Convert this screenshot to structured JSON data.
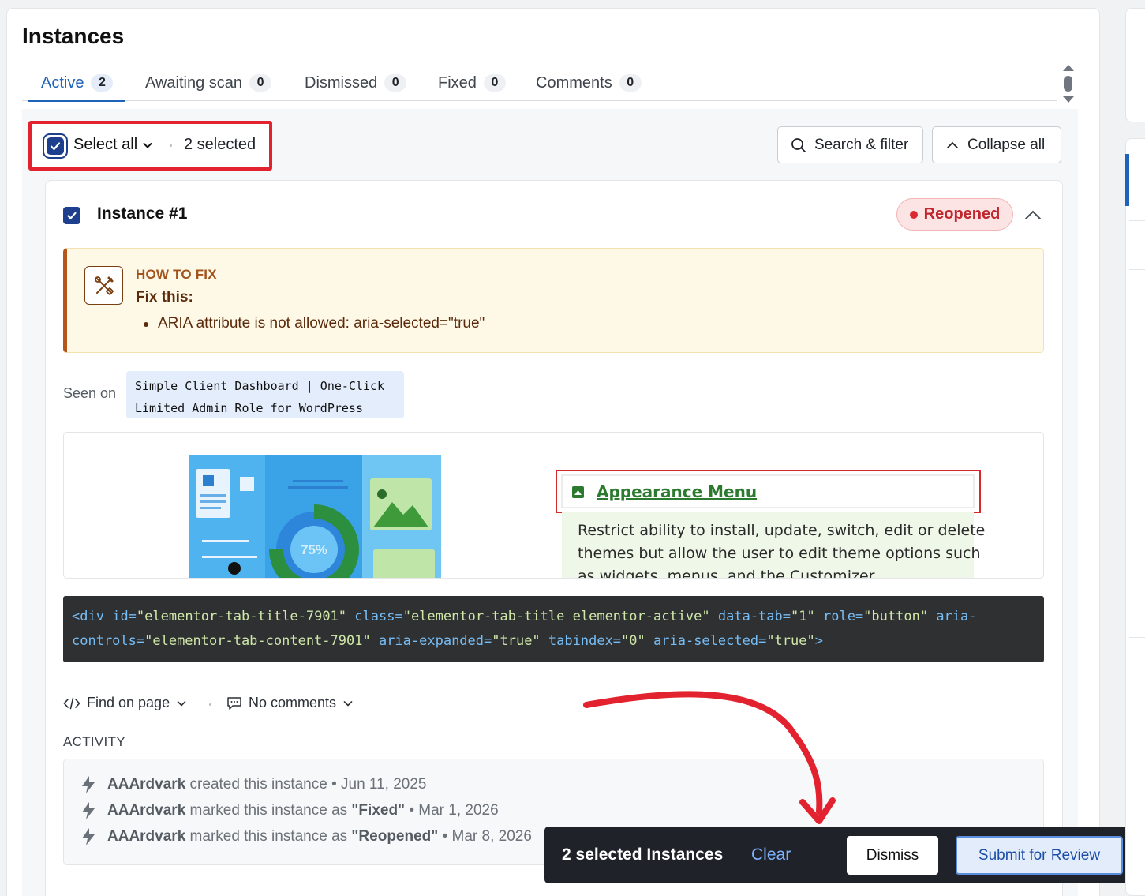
{
  "page": {
    "title": "Instances"
  },
  "tabs": [
    {
      "label": "Active",
      "count": "2"
    },
    {
      "label": "Awaiting scan",
      "count": "0"
    },
    {
      "label": "Dismissed",
      "count": "0"
    },
    {
      "label": "Fixed",
      "count": "0"
    },
    {
      "label": "Comments",
      "count": "0"
    }
  ],
  "toolbar": {
    "select_all": "Select all",
    "selected": "2 selected",
    "search_filter": "Search & filter",
    "collapse_all": "Collapse all"
  },
  "instance": {
    "title": "Instance #1",
    "status": "Reopened",
    "how_to_fix_label": "HOW TO FIX",
    "fix_heading": "Fix this:",
    "fix_item": "ARIA attribute is not allowed: aria-selected=\"true\"",
    "seen_on_label": "Seen on",
    "seen_on_line1": "Simple Client Dashboard | One-Click",
    "seen_on_line2": "Limited Admin Role for WordPress",
    "screenshot": {
      "donut_label": "75%",
      "menu_link": "Appearance Menu",
      "desc_line1": "Restrict ability to install, update, switch, edit or delete",
      "desc_line2": "themes but allow the user to edit theme options such",
      "desc_line3": "as widgets, menus, and the Customizer."
    },
    "code": {
      "tag_open": "<div",
      "a1": "id=",
      "v1": "\"elementor-tab-title-7901\"",
      "a2": "class=",
      "v2": "\"elementor-tab-title elementor-active\"",
      "a3": "data-tab=",
      "v3": "\"1\"",
      "a4": "role=",
      "v4": "\"button\"",
      "a5a": "aria-",
      "a5b": "controls=",
      "v5": "\"elementor-tab-content-7901\"",
      "a6": "aria-expanded=",
      "v6": "\"true\"",
      "a7": "tabindex=",
      "v7": "\"0\"",
      "a8": "aria-selected=",
      "v8": "\"true\"",
      "tag_close": ">"
    },
    "find_on_page": "Find on page",
    "no_comments": "No comments",
    "activity_label": "ACTIVITY",
    "activity": [
      {
        "user": "AAArdvark",
        "action": "created this instance",
        "status": "",
        "date": "• Jun 11, 2025"
      },
      {
        "user": "AAArdvark",
        "action": "marked this instance as",
        "status": "\"Fixed\"",
        "date": "• Mar 1, 2026"
      },
      {
        "user": "AAArdvark",
        "action": "marked this instance as",
        "status": "\"Reopened\"",
        "date": "• Mar 8, 2026"
      }
    ]
  },
  "bulk_bar": {
    "text": "2 selected Instances",
    "clear": "Clear",
    "dismiss": "Dismiss",
    "submit": "Submit for Review"
  },
  "colors": {
    "accent": "#1d63b8",
    "highlight": "#e2222e",
    "reopened": "#c0262d",
    "annotation_arrow": "#e2222e"
  }
}
